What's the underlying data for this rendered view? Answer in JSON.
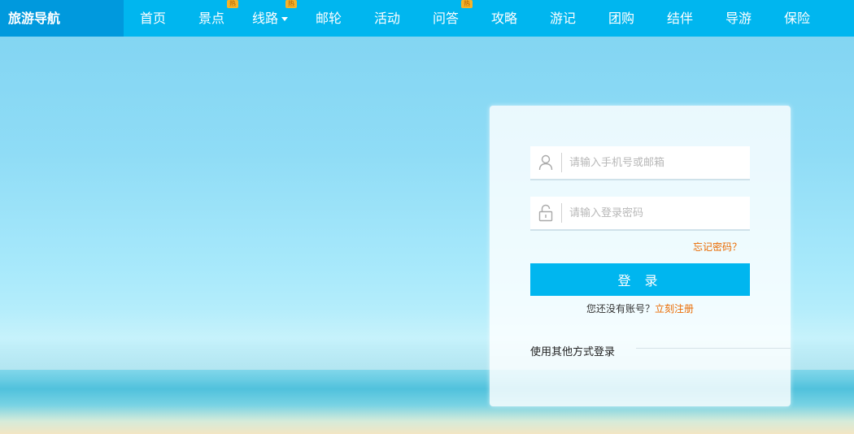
{
  "brand": "旅游导航",
  "nav": [
    {
      "label": "首页",
      "hot": false,
      "dropdown": false
    },
    {
      "label": "景点",
      "hot": true,
      "dropdown": false
    },
    {
      "label": "线路",
      "hot": true,
      "dropdown": true
    },
    {
      "label": "邮轮",
      "hot": false,
      "dropdown": false
    },
    {
      "label": "活动",
      "hot": false,
      "dropdown": false
    },
    {
      "label": "问答",
      "hot": true,
      "dropdown": false
    },
    {
      "label": "攻略",
      "hot": false,
      "dropdown": false
    },
    {
      "label": "游记",
      "hot": false,
      "dropdown": false
    },
    {
      "label": "团购",
      "hot": false,
      "dropdown": false
    },
    {
      "label": "结伴",
      "hot": false,
      "dropdown": false
    },
    {
      "label": "导游",
      "hot": false,
      "dropdown": false
    },
    {
      "label": "保险",
      "hot": false,
      "dropdown": false
    }
  ],
  "hot_badge_text": "热",
  "login": {
    "username_placeholder": "请输入手机号或邮箱",
    "password_placeholder": "请输入登录密码",
    "username_icon": "user-icon",
    "password_icon": "lock-icon",
    "forgot": "忘记密码？",
    "submit": "登 录",
    "no_account": "您还没有账号？",
    "register": "立刻注册",
    "other_methods": "使用其他方式登录"
  },
  "colors": {
    "nav_bg": "#00b6ef",
    "brand_bg": "#0099dd",
    "accent": "#ea6a00",
    "button": "#00b6ef"
  }
}
